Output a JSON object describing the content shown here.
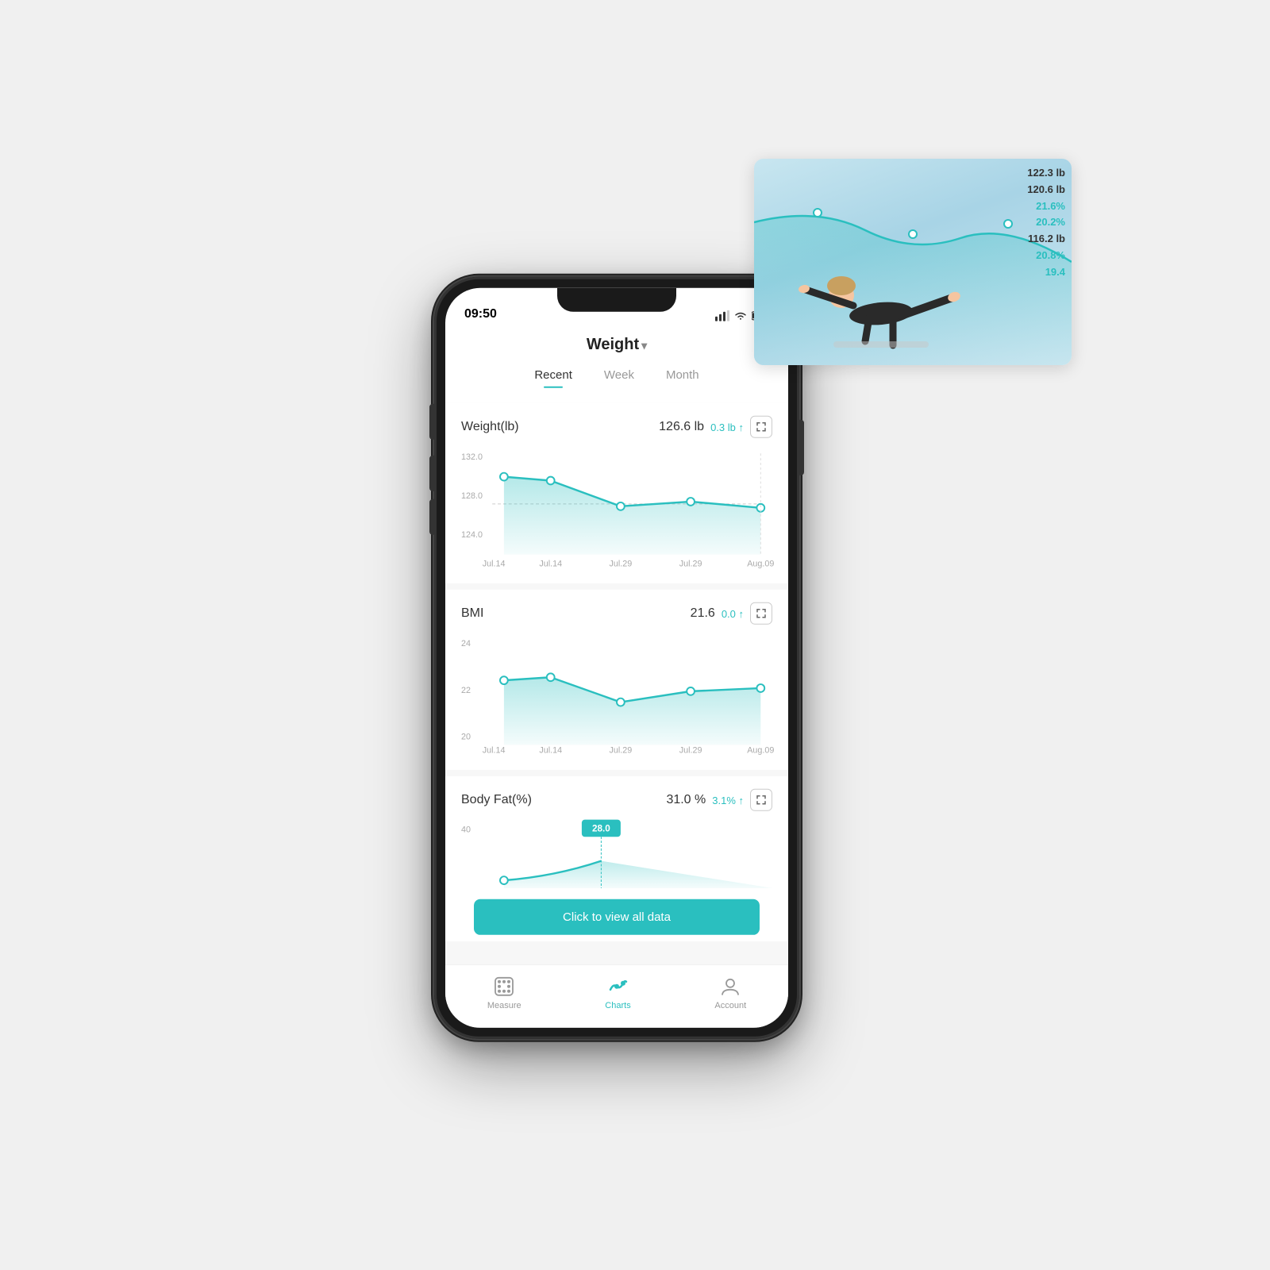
{
  "scene": {
    "background_color": "#f0f0f0"
  },
  "yoga_overlay": {
    "stats": [
      {
        "value": "122.3 lb",
        "color": "dark"
      },
      {
        "value": "120.6 lb",
        "color": "dark"
      },
      {
        "value": "21.6%",
        "color": "teal"
      },
      {
        "value": "20.2%",
        "color": "teal"
      },
      {
        "value": "116.2 lb",
        "color": "dark"
      },
      {
        "value": "20.8%",
        "color": "teal"
      },
      {
        "value": "19.4",
        "color": "teal"
      }
    ]
  },
  "status_bar": {
    "time": "09:50"
  },
  "header": {
    "title": "Weight",
    "arrow": "▾"
  },
  "tabs": [
    {
      "label": "Recent",
      "active": true
    },
    {
      "label": "Week",
      "active": false
    },
    {
      "label": "Month",
      "active": false
    }
  ],
  "weight_chart": {
    "label": "Weight(lb)",
    "value": "126.6 lb",
    "delta": "0.3 lb ↑",
    "x_labels": [
      "Jul.14",
      "Jul.14",
      "Jul.29",
      "Jul.29",
      "Aug.09"
    ],
    "y_labels": [
      "132.0",
      "128.0",
      "124.0"
    ],
    "data_points": [
      129.5,
      129.0,
      126.0,
      126.5,
      126.6
    ]
  },
  "bmi_chart": {
    "label": "BMI",
    "value": "21.6",
    "delta": "0.0 ↑",
    "x_labels": [
      "Jul.14",
      "Jul.14",
      "Jul.29",
      "Jul.29",
      "Aug.09"
    ],
    "y_labels": [
      "24",
      "22",
      "20"
    ],
    "data_points": [
      21.8,
      21.9,
      21.4,
      21.6,
      21.6
    ]
  },
  "bodyfat_chart": {
    "label": "Body Fat(%)",
    "value": "31.0 %",
    "delta": "3.1% ↑",
    "y_labels": [
      "40"
    ],
    "tooltip_value": "28.0"
  },
  "cta_button": {
    "label": "Click to view all data"
  },
  "bottom_nav": [
    {
      "label": "Measure",
      "icon": "dice-icon",
      "active": false
    },
    {
      "label": "Charts",
      "icon": "chart-icon",
      "active": true
    },
    {
      "label": "Account",
      "icon": "account-icon",
      "active": false
    }
  ]
}
